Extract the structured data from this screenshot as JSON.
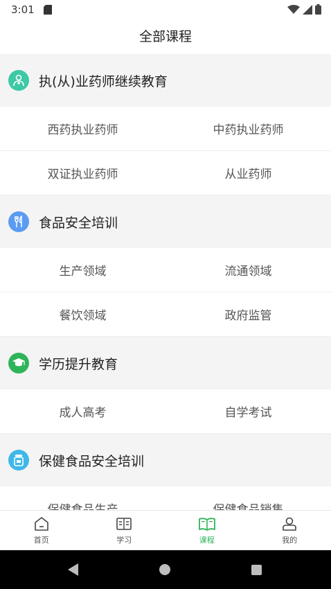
{
  "status": {
    "time": "3:01"
  },
  "header": {
    "title": "全部课程"
  },
  "categories": [
    {
      "title": "执(从)业药师继续教育",
      "icon": "pharmacist-icon",
      "color": "#3cc9a4",
      "items": [
        "西药执业药师",
        "中药执业药师",
        "双证执业药师",
        "从业药师"
      ]
    },
    {
      "title": "食品安全培训",
      "icon": "fork-knife-icon",
      "color": "#5a9cf2",
      "items": [
        "生产领域",
        "流通领域",
        "餐饮领域",
        "政府监管"
      ]
    },
    {
      "title": "学历提升教育",
      "icon": "graduation-cap-icon",
      "color": "#2fb45a",
      "items": [
        "成人高考",
        "自学考试"
      ]
    },
    {
      "title": "保健食品安全培训",
      "icon": "health-jar-icon",
      "color": "#3fb8e8",
      "items": [
        "保健食品生产",
        "保健食品销售"
      ]
    }
  ],
  "tabs": [
    {
      "label": "首页",
      "icon": "home-icon"
    },
    {
      "label": "学习",
      "icon": "book-icon"
    },
    {
      "label": "课程",
      "icon": "open-book-icon",
      "active": true
    },
    {
      "label": "我的",
      "icon": "profile-icon"
    }
  ],
  "colors": {
    "accent": "#2fb45a",
    "section_bg": "#f4f4f4"
  }
}
